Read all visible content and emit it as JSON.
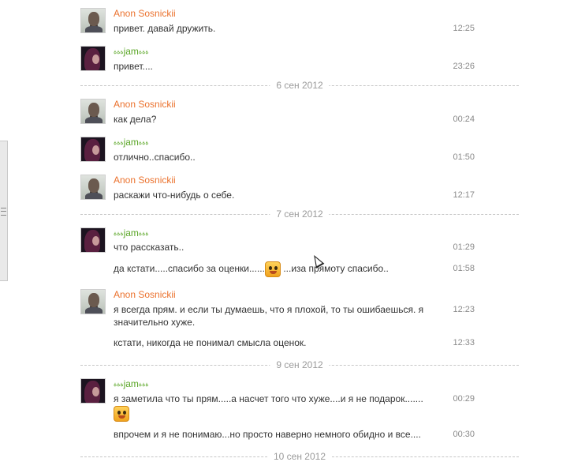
{
  "users": {
    "anon": "Anon Sosnickii",
    "jam": {
      "deco_left": "ةةة",
      "name": "jam",
      "deco_right": "ةةة"
    }
  },
  "colors": {
    "anon_name": "#eb722e",
    "jam_name": "#5aa626",
    "time": "#8a8a8a",
    "separator": "#c6c6c6"
  },
  "messages": [
    {
      "text": "привет. давай дружить.",
      "time": "12:25"
    },
    {
      "text": "привет....",
      "time": "23:26"
    },
    {
      "text": "как дела?",
      "time": "00:24"
    },
    {
      "text": "отлично..спасибо..",
      "time": "01:50"
    },
    {
      "text": "раскажи что-нибудь о себе.",
      "time": "12:17"
    },
    {
      "text": "что рассказать..",
      "time": "01:29"
    },
    {
      "text_before": "да кстати.....спасибо за оценки......",
      "text_after": " ...иза прямоту спасибо..",
      "time": "01:58"
    },
    {
      "text": "я всегда прям. и если ты думаешь, что я плохой, то ты ошибаешься. я значительно хуже.",
      "time": "12:23"
    },
    {
      "text": "кстати, никогда не понимал смысла оценок.",
      "time": "12:33"
    },
    {
      "text": "я заметила что ты прям.....а насчет того что хуже....и я не подарок.......",
      "time": "00:29"
    },
    {
      "text": "впрочем и я не понимаю...но просто наверно немного обидно и все....",
      "time": "00:30"
    }
  ],
  "dates": [
    "6 сен 2012",
    "7 сен 2012",
    "9 сен 2012",
    "10 сен 2012"
  ],
  "icons": {
    "smiley": "smiley-icon",
    "cursor": "cursor-icon"
  }
}
